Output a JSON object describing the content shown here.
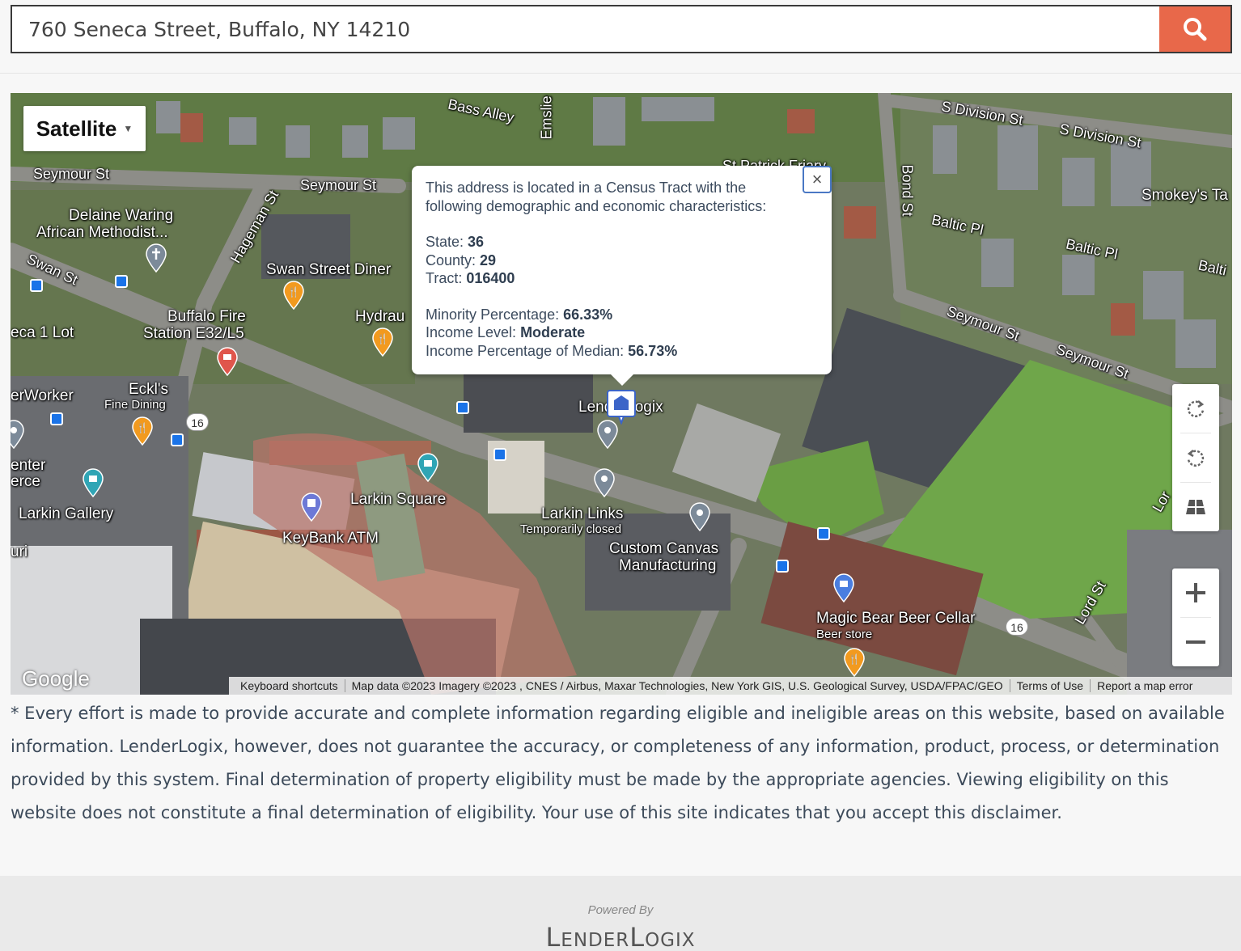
{
  "search": {
    "value": "760 Seneca Street, Buffalo, NY 14210"
  },
  "map": {
    "type_label": "Satellite",
    "labels": {
      "bass_alley": "Bass Alley",
      "emslie": "Emslie",
      "s_division_1": "S Division St",
      "s_division_2": "S Division St",
      "seymour_1": "Seymour St",
      "seymour_2": "Seymour St",
      "seymour_3": "Seymour St",
      "seymour_4": "Seymour St",
      "delaine": "Delaine Waring",
      "african": "African Methodist...",
      "swan": "Swan St",
      "hageman": "Hageman St",
      "swan_diner": "Swan Street Diner",
      "hydrau": "Hydrau",
      "buffalo_fire": "Buffalo Fire",
      "station": "Station E32/L5",
      "seneca_lot": "eca 1 Lot",
      "eckls": "Eckl's",
      "fine_dining": "Fine Dining",
      "erworker": "erWorker",
      "enter": "enter",
      "erce": "erce",
      "larkin_gallery": "Larkin Gallery",
      "uri": "uri",
      "larkin_square": "Larkin Square",
      "keybank": "KeyBank ATM",
      "larkin_links": "Larkin Links",
      "temp_closed": "Temporarily closed",
      "custom_canvas": "Custom Canvas",
      "manufacturing": "Manufacturing",
      "lenderlogix_pin": "LenderLogix",
      "bond": "Bond St",
      "baltic_1": "Baltic Pl",
      "baltic_2": "Baltic Pl",
      "baltic_3": "Balti",
      "smokeys": "Smokey's Ta",
      "magic_bear": "Magic Bear Beer Cellar",
      "beer_store": "Beer store",
      "lord": "Lord St",
      "lord2": "Lor",
      "route16_1": "16",
      "route16_2": "16",
      "stpatrick": "St Patrick Friary"
    },
    "google_logo": "Google",
    "attribution": {
      "shortcuts": "Keyboard shortcuts",
      "data": "Map data ©2023 Imagery ©2023 , CNES / Airbus, Maxar Technologies, New York GIS, U.S. Geological Survey, USDA/FPAC/GEO",
      "terms": "Terms of Use",
      "report": "Report a map error"
    }
  },
  "infowindow": {
    "intro_line1": "This address is located in a Census Tract with the",
    "intro_line2": "following demographic and economic characteristics:",
    "state_label": "State: ",
    "state_value": "36",
    "county_label": "County: ",
    "county_value": "29",
    "tract_label": "Tract: ",
    "tract_value": "016400",
    "minority_label": "Minority Percentage: ",
    "minority_value": "66.33%",
    "income_label": "Income Level: ",
    "income_value": "Moderate",
    "income_pct_label": "Income Percentage of Median: ",
    "income_pct_value": "56.73%",
    "close_symbol": "×"
  },
  "disclaimer": "* Every effort is made to provide accurate and complete information regarding eligible and ineligible areas on this website, based on available information. LenderLogix, however, does not guarantee the accuracy, or completeness of any information, product, process, or determination provided by this system. Final determination of property eligibility must be made by the appropriate agencies. Viewing eligibility on this website does not constitute a final determination of eligibility. Your use of this site indicates that you accept this disclaimer.",
  "footer": {
    "powered_by": "Powered By",
    "brand_l": "L",
    "brand_ender": "ENDER",
    "brand_l2": "L",
    "brand_ogix": "OGIX"
  },
  "colors": {
    "search_button": "#e8684a",
    "text": "#3c4a5a",
    "infowindow_border": "#4a78c4"
  },
  "icons": [
    "search-icon",
    "rotate-cw-icon",
    "rotate-ccw-icon",
    "tilt-icon",
    "zoom-in-icon",
    "zoom-out-icon",
    "close-icon",
    "restaurant-pin-icon",
    "bus-stop-icon",
    "location-pin-icon"
  ]
}
